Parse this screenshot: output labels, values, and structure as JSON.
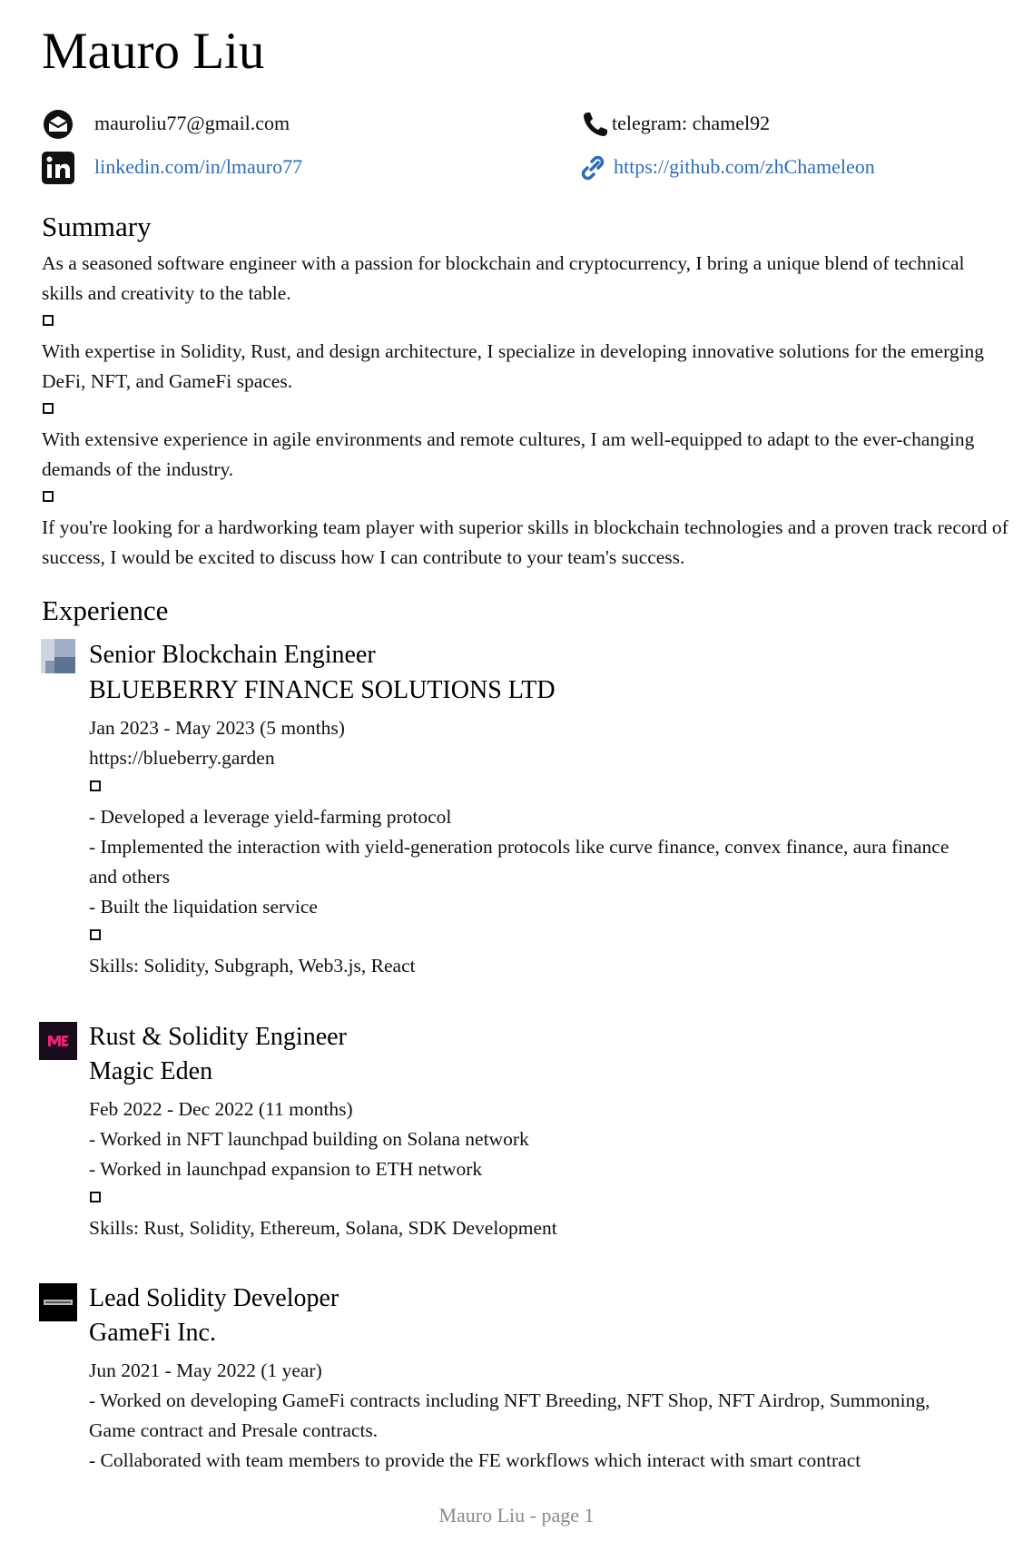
{
  "name": "Mauro Liu",
  "contacts": {
    "email": "mauroliu77@gmail.com",
    "telegram": "telegram: chamel92",
    "linkedin": "linkedin.com/in/lmauro77",
    "github": "https://github.com/zhChameleon"
  },
  "summary": {
    "title": "Summary",
    "paragraphs": [
      "As a seasoned software engineer with a passion for blockchain and cryptocurrency, I bring a unique blend of technical skills and creativity to the table.",
      "With expertise in Solidity, Rust, and design architecture, I specialize in developing innovative solutions for the emerging DeFi, NFT, and GameFi spaces.",
      "With extensive experience in agile environments and remote cultures, I am well-equipped to adapt to the ever-changing demands of the industry.",
      "If you're looking for a hardworking team player with superior skills in blockchain technologies and a proven track record of success, I would be excited to discuss how I can contribute to your team's success."
    ]
  },
  "experience": {
    "title": "Experience",
    "jobs": [
      {
        "title": "Senior Blockchain Engineer",
        "company": "BLUEBERRY FINANCE SOLUTIONS LTD",
        "dates": "Jan 2023 - May 2023 (5 months)",
        "url": "https://blueberry.garden",
        "bullets": [
          "- Developed a leverage yield-farming protocol",
          "- Implemented the interaction with yield-generation protocols like curve finance, convex finance, aura finance and others",
          "- Built the liquidation service"
        ],
        "skills": "Skills: Solidity, Subgraph, Web3.js, React"
      },
      {
        "title": "Rust & Solidity Engineer",
        "company": "Magic Eden",
        "dates": "Feb 2022 - Dec 2022 (11 months)",
        "bullets": [
          "- Worked in NFT launchpad building on Solana network",
          "- Worked in launchpad expansion to ETH network"
        ],
        "skills": "Skills: Rust, Solidity, Ethereum, Solana, SDK Development"
      },
      {
        "title": "Lead Solidity Developer",
        "company": "GameFi Inc.",
        "dates": "Jun 2021 - May 2022 (1 year)",
        "bullets": [
          "- Worked on developing GameFi contracts including NFT Breeding, NFT Shop, NFT Airdrop, Summoning, Game contract and Presale contracts.",
          "- Collaborated with team members to provide the FE workflows which interact with smart contract"
        ]
      }
    ]
  },
  "footer": "Mauro Liu - page 1"
}
